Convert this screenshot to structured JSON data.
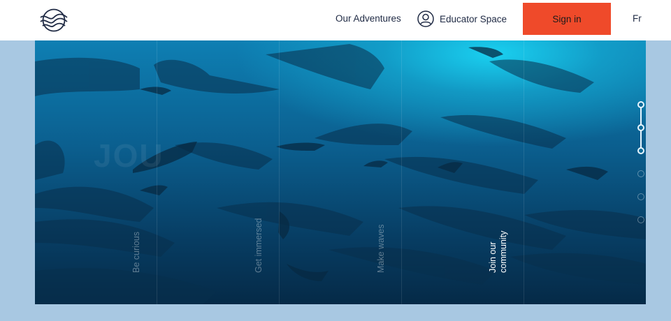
{
  "header": {
    "logo_icon": "waves-globe-icon",
    "nav": {
      "adventures": "Our Adventures",
      "educator": "Educator Space",
      "educator_icon": "user-circle-icon"
    },
    "signin_label": "Sign in",
    "lang_label": "Fr",
    "colors": {
      "signin_bg": "#ef4a2a",
      "nav_text": "#1f2a44"
    }
  },
  "hero": {
    "background_subject": "school of hammerhead sharks underwater",
    "watermark": "JOU",
    "columns": [
      {
        "label": "Be curious",
        "state": "inactive"
      },
      {
        "label": "Get immersed",
        "state": "inactive"
      },
      {
        "label": "Make waves",
        "state": "inactive"
      },
      {
        "label": "Join our community",
        "state": "active"
      }
    ],
    "pager": {
      "total": 6,
      "active_through": 3
    }
  },
  "page": {
    "background": "#a8c8e2"
  }
}
